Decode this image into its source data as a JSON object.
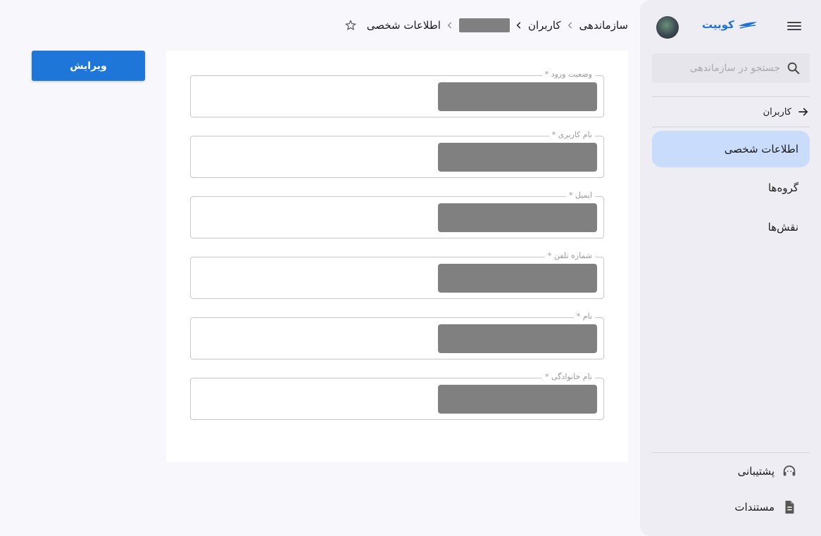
{
  "sidebar": {
    "logo_text": "کوبیت",
    "search_placeholder": "جستجو در سازماندهی",
    "back_label": "کاربران",
    "items": [
      {
        "label": "اطلاعات شخصی",
        "active": true
      },
      {
        "label": "گروه‌ها",
        "active": false
      },
      {
        "label": "نقش‌ها",
        "active": false
      }
    ],
    "footer": {
      "support_label": "پشتیبانی",
      "docs_label": "مستندات"
    }
  },
  "breadcrumb": {
    "items": [
      "سازماندهی",
      "کاربران",
      "اطلاعات شخصی"
    ]
  },
  "toolbar": {
    "edit_label": "ویرایش"
  },
  "form": {
    "fields": [
      {
        "label": "وضعیت ورود *"
      },
      {
        "label": "نام کاربری *"
      },
      {
        "label": "ایمیل *"
      },
      {
        "label": "شماره تلفن *"
      },
      {
        "label": "نام *"
      },
      {
        "label": "نام خانوادگی *"
      }
    ]
  },
  "colors": {
    "accent": "#1d76d8",
    "active_nav": "#c9dcfb",
    "redacted": "#808080"
  }
}
